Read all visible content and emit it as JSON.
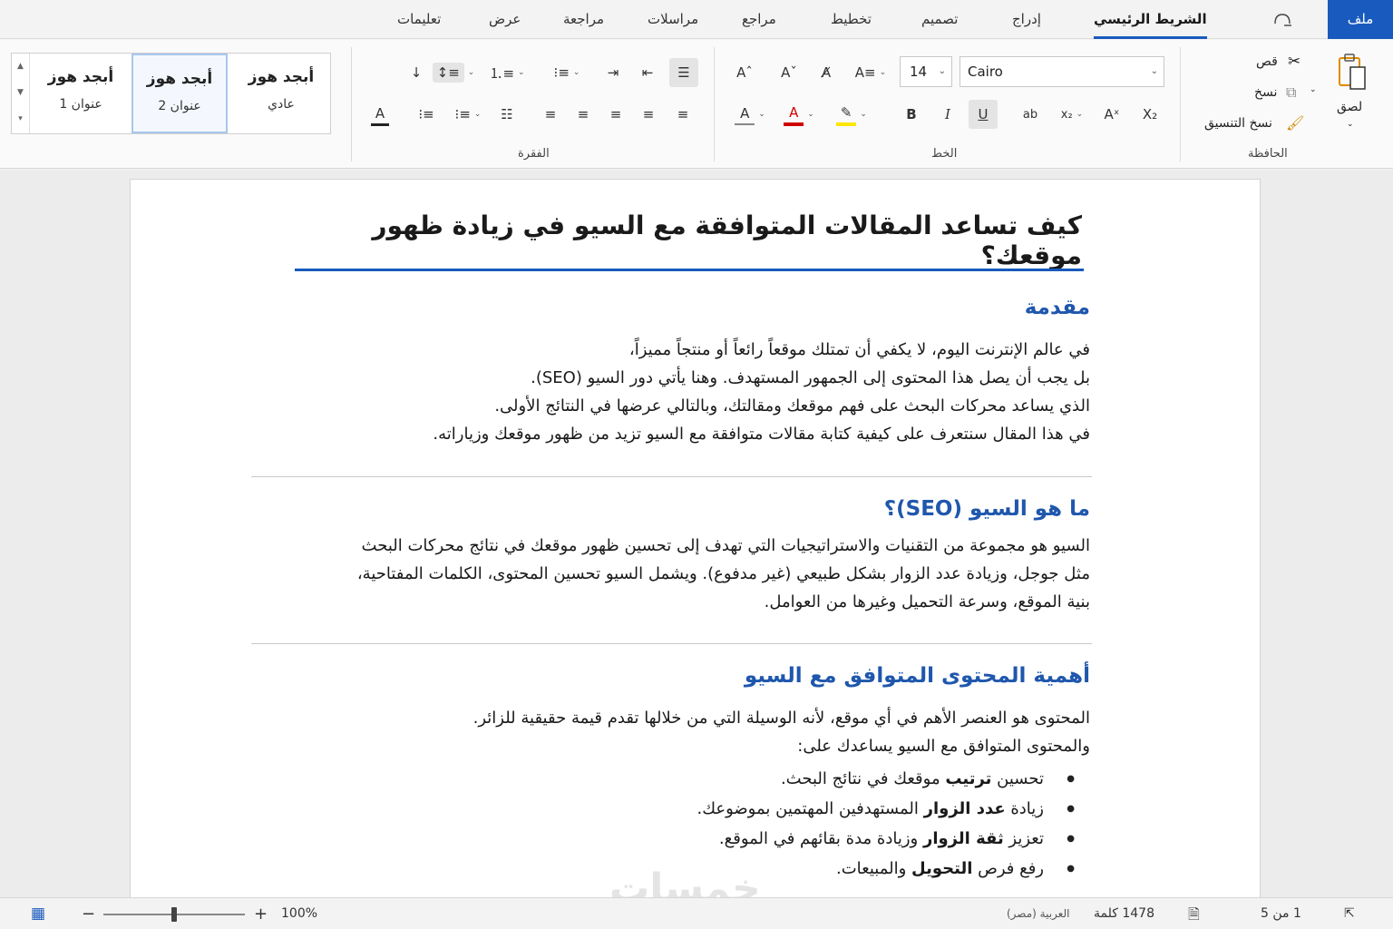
{
  "tabs": {
    "file": "ملف",
    "items": [
      "الشريط الرئيسي",
      "إدراج",
      "تصميم",
      "تخطيط",
      "مراجع",
      "مراسلات",
      "مراجعة",
      "عرض",
      "تعليمات"
    ],
    "active": "الشريط الرئيسي",
    "icon": "lightbulb-icon"
  },
  "ribbon": {
    "clipboard": {
      "label": "الحافظة",
      "paste": "لصق",
      "cut": "قص",
      "copy": "نسخ",
      "format_painter": "نسخ التنسيق"
    },
    "font": {
      "label": "الخط",
      "name": "Cairo",
      "size": "14",
      "highlight_color": "#ffe600",
      "font_color": "#d00000"
    },
    "paragraph": {
      "label": "الفقرة"
    },
    "styles": {
      "items": [
        {
          "main": "أبجد هوز",
          "sub": "عادي"
        },
        {
          "main": "أبجد هوز",
          "sub": "عنوان 2"
        },
        {
          "main": "أبجد هوز",
          "sub": "عنوان 1"
        }
      ],
      "selected_index": 1
    }
  },
  "document": {
    "title": "كيف تساعد المقالات المتوافقة مع السيو في زيادة ظهور موقعك؟",
    "sections": [
      {
        "heading": "مقدمة",
        "lines": [
          "في عالم الإنترنت اليوم، لا يكفي أن تمتلك موقعاً رائعاً أو منتجاً مميزاً،",
          "بل يجب أن يصل هذا المحتوى إلى الجمهور المستهدف. وهنا يأتي دور السيو (SEO).",
          "الذي يساعد محركات البحث على فهم موقعك ومقالتك، وبالتالي عرضها في النتائج الأولى.",
          "في هذا المقال سنتعرف على كيفية كتابة مقالات متوافقة مع السيو تزيد من ظهور موقعك وزياراته."
        ]
      },
      {
        "heading": "ما هو السيو (SEO)؟",
        "lines": [
          "السيو هو مجموعة من التقنيات والاستراتيجيات التي تهدف إلى تحسين ظهور موقعك في نتائج محركات البحث",
          "مثل جوجل، وزيادة عدد الزوار بشكل طبيعي (غير مدفوع). ويشمل السيو تحسين المحتوى، الكلمات المفتاحية،",
          "بنية الموقع، وسرعة التحميل وغيرها من العوامل."
        ]
      },
      {
        "heading": "أهمية المحتوى المتوافق مع السيو",
        "lines": [
          "المحتوى هو العنصر الأهم في أي موقع، لأنه الوسيلة التي من خلالها تقدم قيمة حقيقية للزائر.",
          "والمحتوى المتوافق مع السيو يساعدك على:"
        ],
        "bullets": [
          {
            "pre": "تحسين ",
            "bold": "ترتيب",
            "post": " موقعك في نتائج البحث."
          },
          {
            "pre": "زيادة ",
            "bold": "عدد الزوار",
            "post": " المستهدفين المهتمين بموضوعك."
          },
          {
            "pre": "تعزيز ",
            "bold": "ثقة الزوار",
            "post": " وزيادة مدة بقائهم في الموقع."
          },
          {
            "pre": "رفع فرص ",
            "bold": "التحويل",
            "post": " والمبيعات."
          }
        ]
      }
    ]
  },
  "status": {
    "page": "1 من 5",
    "words": "1478 كلمة",
    "language": "العربية (مصر)",
    "zoom": "100%",
    "zoom_fraction": 0.5,
    "zoom_minus": "−",
    "zoom_plus": "+"
  },
  "watermark": "خمسات"
}
